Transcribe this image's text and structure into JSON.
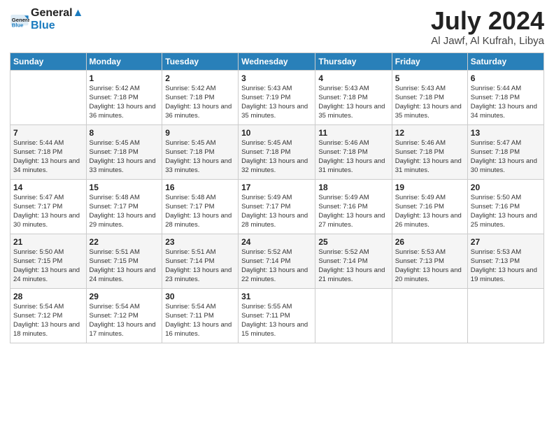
{
  "header": {
    "logo_line1": "General",
    "logo_line2": "Blue",
    "month_title": "July 2024",
    "location": "Al Jawf, Al Kufrah, Libya"
  },
  "weekdays": [
    "Sunday",
    "Monday",
    "Tuesday",
    "Wednesday",
    "Thursday",
    "Friday",
    "Saturday"
  ],
  "weeks": [
    [
      {
        "day": "",
        "sunrise": "",
        "sunset": "",
        "daylight": ""
      },
      {
        "day": "1",
        "sunrise": "Sunrise: 5:42 AM",
        "sunset": "Sunset: 7:18 PM",
        "daylight": "Daylight: 13 hours and 36 minutes."
      },
      {
        "day": "2",
        "sunrise": "Sunrise: 5:42 AM",
        "sunset": "Sunset: 7:18 PM",
        "daylight": "Daylight: 13 hours and 36 minutes."
      },
      {
        "day": "3",
        "sunrise": "Sunrise: 5:43 AM",
        "sunset": "Sunset: 7:19 PM",
        "daylight": "Daylight: 13 hours and 35 minutes."
      },
      {
        "day": "4",
        "sunrise": "Sunrise: 5:43 AM",
        "sunset": "Sunset: 7:18 PM",
        "daylight": "Daylight: 13 hours and 35 minutes."
      },
      {
        "day": "5",
        "sunrise": "Sunrise: 5:43 AM",
        "sunset": "Sunset: 7:18 PM",
        "daylight": "Daylight: 13 hours and 35 minutes."
      },
      {
        "day": "6",
        "sunrise": "Sunrise: 5:44 AM",
        "sunset": "Sunset: 7:18 PM",
        "daylight": "Daylight: 13 hours and 34 minutes."
      }
    ],
    [
      {
        "day": "7",
        "sunrise": "Sunrise: 5:44 AM",
        "sunset": "Sunset: 7:18 PM",
        "daylight": "Daylight: 13 hours and 34 minutes."
      },
      {
        "day": "8",
        "sunrise": "Sunrise: 5:45 AM",
        "sunset": "Sunset: 7:18 PM",
        "daylight": "Daylight: 13 hours and 33 minutes."
      },
      {
        "day": "9",
        "sunrise": "Sunrise: 5:45 AM",
        "sunset": "Sunset: 7:18 PM",
        "daylight": "Daylight: 13 hours and 33 minutes."
      },
      {
        "day": "10",
        "sunrise": "Sunrise: 5:45 AM",
        "sunset": "Sunset: 7:18 PM",
        "daylight": "Daylight: 13 hours and 32 minutes."
      },
      {
        "day": "11",
        "sunrise": "Sunrise: 5:46 AM",
        "sunset": "Sunset: 7:18 PM",
        "daylight": "Daylight: 13 hours and 31 minutes."
      },
      {
        "day": "12",
        "sunrise": "Sunrise: 5:46 AM",
        "sunset": "Sunset: 7:18 PM",
        "daylight": "Daylight: 13 hours and 31 minutes."
      },
      {
        "day": "13",
        "sunrise": "Sunrise: 5:47 AM",
        "sunset": "Sunset: 7:18 PM",
        "daylight": "Daylight: 13 hours and 30 minutes."
      }
    ],
    [
      {
        "day": "14",
        "sunrise": "Sunrise: 5:47 AM",
        "sunset": "Sunset: 7:17 PM",
        "daylight": "Daylight: 13 hours and 30 minutes."
      },
      {
        "day": "15",
        "sunrise": "Sunrise: 5:48 AM",
        "sunset": "Sunset: 7:17 PM",
        "daylight": "Daylight: 13 hours and 29 minutes."
      },
      {
        "day": "16",
        "sunrise": "Sunrise: 5:48 AM",
        "sunset": "Sunset: 7:17 PM",
        "daylight": "Daylight: 13 hours and 28 minutes."
      },
      {
        "day": "17",
        "sunrise": "Sunrise: 5:49 AM",
        "sunset": "Sunset: 7:17 PM",
        "daylight": "Daylight: 13 hours and 28 minutes."
      },
      {
        "day": "18",
        "sunrise": "Sunrise: 5:49 AM",
        "sunset": "Sunset: 7:16 PM",
        "daylight": "Daylight: 13 hours and 27 minutes."
      },
      {
        "day": "19",
        "sunrise": "Sunrise: 5:49 AM",
        "sunset": "Sunset: 7:16 PM",
        "daylight": "Daylight: 13 hours and 26 minutes."
      },
      {
        "day": "20",
        "sunrise": "Sunrise: 5:50 AM",
        "sunset": "Sunset: 7:16 PM",
        "daylight": "Daylight: 13 hours and 25 minutes."
      }
    ],
    [
      {
        "day": "21",
        "sunrise": "Sunrise: 5:50 AM",
        "sunset": "Sunset: 7:15 PM",
        "daylight": "Daylight: 13 hours and 24 minutes."
      },
      {
        "day": "22",
        "sunrise": "Sunrise: 5:51 AM",
        "sunset": "Sunset: 7:15 PM",
        "daylight": "Daylight: 13 hours and 24 minutes."
      },
      {
        "day": "23",
        "sunrise": "Sunrise: 5:51 AM",
        "sunset": "Sunset: 7:14 PM",
        "daylight": "Daylight: 13 hours and 23 minutes."
      },
      {
        "day": "24",
        "sunrise": "Sunrise: 5:52 AM",
        "sunset": "Sunset: 7:14 PM",
        "daylight": "Daylight: 13 hours and 22 minutes."
      },
      {
        "day": "25",
        "sunrise": "Sunrise: 5:52 AM",
        "sunset": "Sunset: 7:14 PM",
        "daylight": "Daylight: 13 hours and 21 minutes."
      },
      {
        "day": "26",
        "sunrise": "Sunrise: 5:53 AM",
        "sunset": "Sunset: 7:13 PM",
        "daylight": "Daylight: 13 hours and 20 minutes."
      },
      {
        "day": "27",
        "sunrise": "Sunrise: 5:53 AM",
        "sunset": "Sunset: 7:13 PM",
        "daylight": "Daylight: 13 hours and 19 minutes."
      }
    ],
    [
      {
        "day": "28",
        "sunrise": "Sunrise: 5:54 AM",
        "sunset": "Sunset: 7:12 PM",
        "daylight": "Daylight: 13 hours and 18 minutes."
      },
      {
        "day": "29",
        "sunrise": "Sunrise: 5:54 AM",
        "sunset": "Sunset: 7:12 PM",
        "daylight": "Daylight: 13 hours and 17 minutes."
      },
      {
        "day": "30",
        "sunrise": "Sunrise: 5:54 AM",
        "sunset": "Sunset: 7:11 PM",
        "daylight": "Daylight: 13 hours and 16 minutes."
      },
      {
        "day": "31",
        "sunrise": "Sunrise: 5:55 AM",
        "sunset": "Sunset: 7:11 PM",
        "daylight": "Daylight: 13 hours and 15 minutes."
      },
      {
        "day": "",
        "sunrise": "",
        "sunset": "",
        "daylight": ""
      },
      {
        "day": "",
        "sunrise": "",
        "sunset": "",
        "daylight": ""
      },
      {
        "day": "",
        "sunrise": "",
        "sunset": "",
        "daylight": ""
      }
    ]
  ]
}
